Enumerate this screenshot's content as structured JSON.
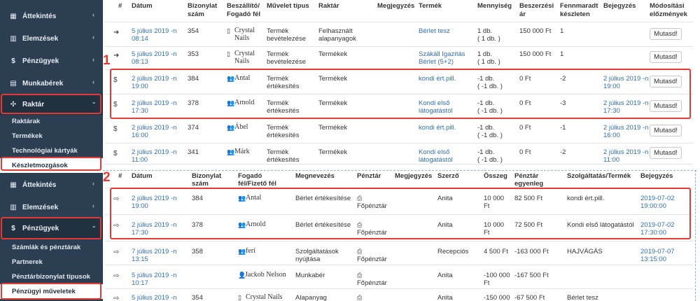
{
  "sidebar": {
    "items": [
      {
        "icon": "grid-icon",
        "label": "Áttekintés"
      },
      {
        "icon": "bar-chart-icon",
        "label": "Elemzések"
      },
      {
        "icon": "dollar-icon",
        "label": "Pénzügyek"
      },
      {
        "icon": "list-icon",
        "label": "Munkabérek"
      },
      {
        "icon": "cubes-icon",
        "label": "Raktár"
      }
    ],
    "raktar_sub": [
      "Raktárak",
      "Termékek",
      "Technológiai kártyák",
      "Készletmozgások"
    ],
    "items2": [
      {
        "icon": "grid-icon",
        "label": "Áttekintés"
      },
      {
        "icon": "bar-chart-icon",
        "label": "Elemzések"
      },
      {
        "icon": "dollar-icon",
        "label": "Pénzügyek"
      }
    ],
    "penzugy_sub": [
      "Számlák és pénztárak",
      "Partnerek",
      "Pénztárbizonylat típusok",
      "Pénzügyi műveletek"
    ]
  },
  "annotations": {
    "one": "1",
    "two": "2"
  },
  "inventory": {
    "headers": {
      "num": "#",
      "date": "Dátum",
      "doc": "Bizonylat",
      "doc2": "szám",
      "partner": "Beszállító/",
      "partner2": "Fogadó fél",
      "op": "Művelet típus",
      "warehouse": "Raktár",
      "note": "Megjegyzés",
      "product": "Termék",
      "qty": "Mennyiség",
      "price": "Beszerzési",
      "price2": "ár",
      "remain": "Fennmaradt",
      "remain2": "készleten",
      "booking": "Bejegyzés",
      "history": "Módosítási",
      "history2": "előzmények"
    },
    "rows": [
      {
        "icon": "sign-in-icon",
        "d1": "5 július 2019 -n",
        "d2": "08:14",
        "doc": "354",
        "p1": "Crystal",
        "p2": "Nails",
        "pIcon": "building-icon",
        "o1": "Termék",
        "o2": "bevételezése",
        "w1": "Felhasznált",
        "w2": "alapanyagok",
        "pr1": "Bérlet tesz",
        "pr2": "",
        "q1": "1 db.",
        "q2": "( 1 db. )",
        "price": "150 000 Ft",
        "rem": "1",
        "b1": "",
        "b2": "",
        "btn": "Mutasd!"
      },
      {
        "icon": "sign-in-icon",
        "d1": "5 július 2019 -n",
        "d2": "08:13",
        "doc": "353",
        "p1": "Crystal",
        "p2": "Nails",
        "pIcon": "building-icon",
        "o1": "Termék",
        "o2": "bevételezése",
        "w1": "Termékek",
        "w2": "",
        "pr1": "Szákáll Igazítás",
        "pr2": "Bérlet (5+2)",
        "q1": "1 db.",
        "q2": "( 1 db. )",
        "price": "150 000 Ft",
        "rem": "1",
        "b1": "",
        "b2": "",
        "btn": "Mutasd!"
      },
      {
        "icon": "dollar-icon",
        "d1": "2 július 2019 -n",
        "d2": "19:00",
        "doc": "384",
        "p1": "Antal",
        "p2": "",
        "pIcon": "users-icon",
        "o1": "Termék",
        "o2": "értékesítés",
        "w1": "Termékek",
        "w2": "",
        "pr1": "kondi ért.pill.",
        "pr2": "",
        "q1": "-1 db.",
        "q2": "( -1 db. )",
        "price": "0 Ft",
        "rem": "-2",
        "b1": "2 július 2019 -n",
        "b2": "19:00",
        "btn": "Mutasd!"
      },
      {
        "icon": "dollar-icon",
        "d1": "2 július 2019 -n",
        "d2": "17:30",
        "doc": "378",
        "p1": "Arnold",
        "p2": "",
        "pIcon": "users-icon",
        "o1": "Termék",
        "o2": "értékesítés",
        "w1": "Termékek",
        "w2": "",
        "pr1": "Kondi első",
        "pr2": "látogatástól",
        "q1": "-1 db.",
        "q2": "( -1 db. )",
        "price": "0 Ft",
        "rem": "-3",
        "b1": "2 július 2019 -n",
        "b2": "17:30",
        "btn": "Mutasd!"
      },
      {
        "icon": "dollar-icon",
        "d1": "2 július 2019 -n",
        "d2": "16:00",
        "doc": "374",
        "p1": "Ábel",
        "p2": "",
        "pIcon": "users-icon",
        "o1": "Termék",
        "o2": "értékesítés",
        "w1": "Termékek",
        "w2": "",
        "pr1": "kondi ért.pill.",
        "pr2": "",
        "q1": "-1 db.",
        "q2": "( -1 db. )",
        "price": "0 Ft",
        "rem": "-1",
        "b1": "2 július 2019 -n",
        "b2": "16:00",
        "btn": "Mutasd!"
      },
      {
        "icon": "dollar-icon",
        "d1": "2 július 2019 -n",
        "d2": "11:00",
        "doc": "341",
        "p1": "Márk",
        "p2": "",
        "pIcon": "users-icon",
        "o1": "Termék",
        "o2": "értékesítés",
        "w1": "Termékek",
        "w2": "",
        "pr1": "Kondi első",
        "pr2": "látogatástól",
        "q1": "-1 db.",
        "q2": "( -1 db. )",
        "price": "0 Ft",
        "rem": "-2",
        "b1": "2 július 2019 -n",
        "b2": "11:00",
        "btn": "Mutasd!"
      }
    ]
  },
  "finance": {
    "headers": {
      "num": "#",
      "date": "Dátum",
      "doc": "Bizonylat",
      "doc2": "szám",
      "partner": "Fogadó",
      "partner2": "fél/Fizető fél",
      "name": "Megnevezés",
      "till": "Pénztár",
      "note": "Megjegyzés",
      "author": "Szerző",
      "amount": "Összeg",
      "bal": "Pénztár",
      "bal2": "egyenleg",
      "service": "Szolgáltatás/Termék",
      "booking": "Bejegyzés"
    },
    "rows": [
      {
        "icon": "sign-out-icon",
        "d1": "2 július 2019 -n",
        "d2": "19:00",
        "doc": "384",
        "p": "Antal",
        "pIcon": "users-icon",
        "name": "Bérlet értékesítése",
        "till": "Főpénztár",
        "author": "Anita",
        "a1": "10 000",
        "a2": "Ft",
        "bal": "82 500 Ft",
        "svc": "kondi ért.pill.",
        "b1": "2019-07-02",
        "b2": "19:00:00"
      },
      {
        "icon": "sign-out-icon",
        "d1": "2 július 2019 -n",
        "d2": "17:30",
        "doc": "378",
        "p": "Arnold",
        "pIcon": "users-icon",
        "name": "Bérlet értékesítése",
        "till": "Főpénztár",
        "author": "Anita",
        "a1": "10 000",
        "a2": "Ft",
        "bal": "72 500 Ft",
        "svc": "Kondi első látogatástól",
        "b1": "2019-07-02",
        "b2": "17:30:00"
      },
      {
        "icon": "sign-out-icon",
        "d1": "7 július 2019 -n",
        "d2": "13:15",
        "doc": "358",
        "p": "feri",
        "pIcon": "users-icon",
        "name": "Szolgáltatások",
        "name2": "nyújtása",
        "till": "Főpénztár",
        "author": "Recepciós",
        "a1": "4 500 Ft",
        "a2": "",
        "bal": "-163 000 Ft",
        "svc": "HAJVÁGÁS",
        "b1": "2019-07-07",
        "b2": "13:15:00"
      },
      {
        "icon": "sign-out-icon",
        "d1": "5 július 2019 -n",
        "d2": "10:17",
        "doc": "",
        "p": "Jackob Nelson",
        "pIcon": "user-icon",
        "name": "Munkabér",
        "till": "Főpénztár",
        "author": "Anita",
        "a1": "-100 000",
        "a2": "Ft",
        "bal": "-167 500 Ft",
        "svc": "",
        "b1": "",
        "b2": ""
      },
      {
        "icon": "sign-out-icon",
        "d1": "5 július 2019 -n",
        "d2": "",
        "doc": "354",
        "p": "Crystal Nails",
        "pIcon": "building-icon",
        "name": "Alapanyag",
        "till": "",
        "author": "Anita",
        "a1": "-150 000",
        "a2": "",
        "bal": "-67 500 Ft",
        "svc": "Bérlet tesz",
        "b1": "",
        "b2": ""
      }
    ]
  }
}
